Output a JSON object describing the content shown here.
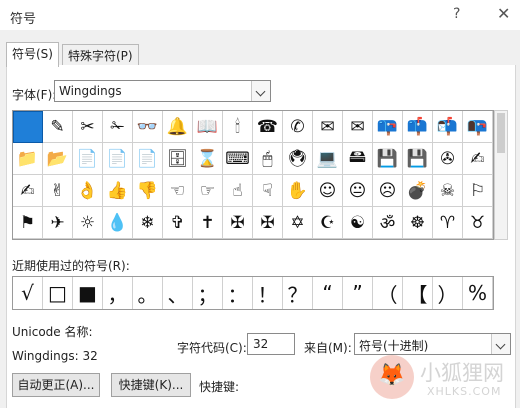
{
  "window": {
    "title": "符号",
    "help_icon": "?",
    "close_icon": "✕"
  },
  "tabs": [
    {
      "label": "符号(S)",
      "active": true
    },
    {
      "label": "特殊字符(P)",
      "active": false
    }
  ],
  "font": {
    "label": "字体(F):",
    "value": "Wingdings"
  },
  "symbols": [
    " ",
    "✎",
    "✂",
    "✁",
    "👓",
    "🔔",
    "📖",
    "🕯",
    "☎",
    "✆",
    "✉",
    "✉",
    "📪",
    "📫",
    "📬",
    "📭",
    "📁",
    "📂",
    "📄",
    "📄",
    "📄",
    "🗄",
    "⌛",
    "⌨",
    "🖱",
    "🖲",
    "💻",
    "🖴",
    "💾",
    "💾",
    "✇",
    "✍",
    "✍",
    "✌",
    "👌",
    "👍",
    "👎",
    "☜",
    "☞",
    "☝",
    "☟",
    "✋",
    "☺",
    "😐",
    "☹",
    "💣",
    "☠",
    "⚐",
    "⚑",
    "✈",
    "☼",
    "💧",
    "❄",
    "✞",
    "✝",
    "✠",
    "✠",
    "✡",
    "☪",
    "☯",
    "ॐ",
    "☸",
    "♈",
    "♉"
  ],
  "recent": {
    "label": "近期使用过的符号(R):",
    "items": [
      "√",
      "□",
      "■",
      "，",
      "。",
      "、",
      "；",
      "：",
      "！",
      "？",
      "“",
      "”",
      "（",
      "【",
      "）",
      "%"
    ]
  },
  "unicode_name_label": "Unicode 名称:",
  "char_desc": "Wingdings: 32",
  "char_code": {
    "label": "字符代码(C):",
    "value": "32"
  },
  "from": {
    "label": "来自(M):",
    "value": "符号(十进制)"
  },
  "buttons": {
    "autocorrect": "自动更正(A)...",
    "shortcut": "快捷键(K)...",
    "shortcut_label": "快捷键:"
  },
  "watermark": {
    "cn": "小狐狸网",
    "en": "XHLKS.COM"
  }
}
